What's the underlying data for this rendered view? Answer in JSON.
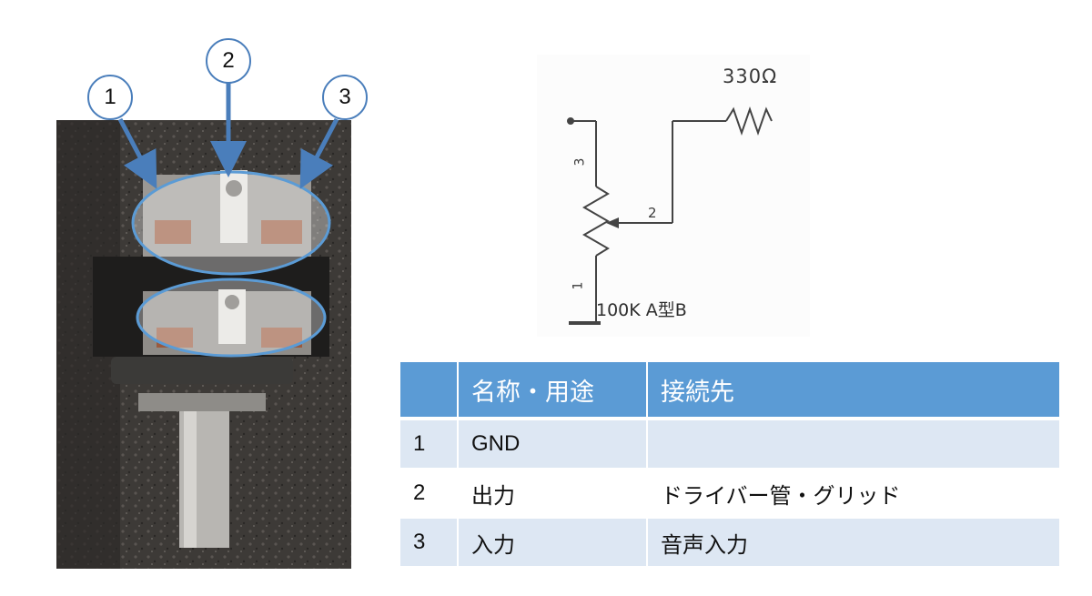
{
  "callouts": [
    "1",
    "2",
    "3"
  ],
  "schematic": {
    "resistor_value": "330Ω",
    "pot_label": "100K A型B",
    "pin_labels": [
      "1",
      "2",
      "3"
    ]
  },
  "table": {
    "headers": [
      "",
      "名称・用途",
      "接続先"
    ],
    "rows": [
      {
        "num": "1",
        "name": "GND",
        "dest": ""
      },
      {
        "num": "2",
        "name": "出力",
        "dest": "ドライバー管・グリッド"
      },
      {
        "num": "3",
        "name": "入力",
        "dest": "音声入力"
      }
    ]
  },
  "colors": {
    "accent": "#5b9bd5",
    "callout_stroke": "#4a7ebb",
    "row_shade": "#dde7f3"
  }
}
